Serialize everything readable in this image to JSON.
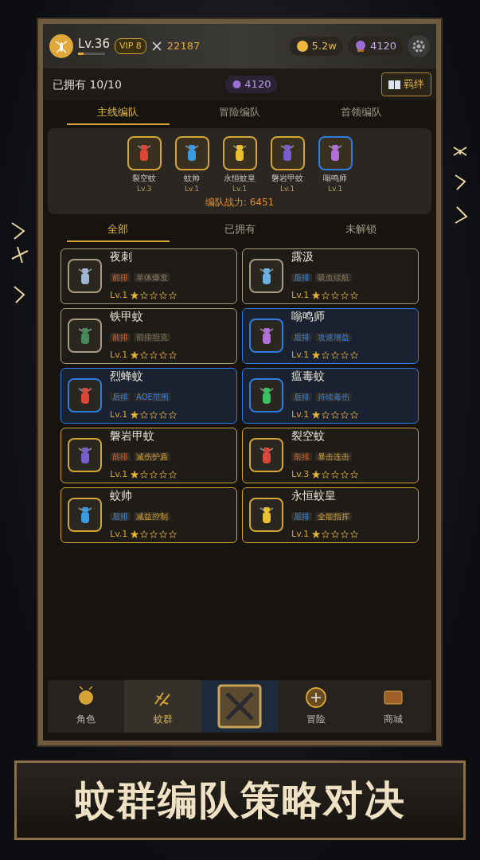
{
  "player": {
    "level_label": "Lv.36",
    "level": 0.2,
    "vip": "VIP 8",
    "power": "22187",
    "coins": "5.2w",
    "gems": "4120"
  },
  "owned": {
    "label": "已拥有 10/10",
    "gems": "4120",
    "bond_button": "羁绊"
  },
  "team_tabs": [
    {
      "label": "主线编队",
      "selected": true
    },
    {
      "label": "冒险编队",
      "selected": false
    },
    {
      "label": "首领编队",
      "selected": false
    }
  ],
  "formation": {
    "members": [
      {
        "name": "裂空蚊",
        "level": "Lv.3",
        "kind": "epic",
        "icon": {
          "color": "#d9483a"
        }
      },
      {
        "name": "蚊帅",
        "level": "Lv.1",
        "kind": "epic",
        "icon": {
          "color": "#3a9be0"
        }
      },
      {
        "name": "永恒蚊皇",
        "level": "Lv.1",
        "kind": "epic",
        "icon": {
          "color": "#e8c230"
        }
      },
      {
        "name": "磐岩甲蚊",
        "level": "Lv.1",
        "kind": "epic",
        "icon": {
          "color": "#7a5ed0"
        }
      },
      {
        "name": "嗡鸣师",
        "level": "Lv.1",
        "kind": "rare",
        "icon": {
          "color": "#b070d8"
        }
      }
    ],
    "power": "编队战力: 6451"
  },
  "filter_tabs": [
    {
      "label": "全部",
      "selected": true
    },
    {
      "label": "已拥有",
      "selected": false
    },
    {
      "label": "未解锁",
      "selected": false
    }
  ],
  "units": [
    {
      "name": "夜刺",
      "kind": "common",
      "icon": {
        "color": "#9fb4d0"
      },
      "position": {
        "text": "前排",
        "kind": "front"
      },
      "trait": "单体爆发",
      "level": "Lv.1",
      "stars": 1
    },
    {
      "name": "露汲",
      "kind": "common",
      "icon": {
        "color": "#6ab0e0"
      },
      "position": {
        "text": "后排",
        "kind": "back"
      },
      "trait": "吸血续航",
      "level": "Lv.1",
      "stars": 1
    },
    {
      "name": "铁甲蚊",
      "kind": "common",
      "icon": {
        "color": "#4a8a5a"
      },
      "position": {
        "text": "前排",
        "kind": "front"
      },
      "trait": "前排坦克",
      "level": "Lv.1",
      "stars": 1
    },
    {
      "name": "嗡鸣师",
      "kind": "rare",
      "icon": {
        "color": "#b070d8"
      },
      "position": {
        "text": "后排",
        "kind": "back"
      },
      "trait": "攻速增益",
      "level": "Lv.1",
      "stars": 1
    },
    {
      "name": "烈蜂蚊",
      "kind": "rare",
      "icon": {
        "color": "#d9483a"
      },
      "position": {
        "text": "后排",
        "kind": "back"
      },
      "trait": "AOE范围",
      "level": "Lv.1",
      "stars": 1
    },
    {
      "name": "瘟毒蚊",
      "kind": "rare",
      "icon": {
        "color": "#3ac060"
      },
      "position": {
        "text": "后排",
        "kind": "back"
      },
      "trait": "持续毒伤",
      "level": "Lv.1",
      "stars": 1
    },
    {
      "name": "磐岩甲蚊",
      "kind": "epic",
      "icon": {
        "color": "#7a5ed0"
      },
      "position": {
        "text": "前排",
        "kind": "front"
      },
      "trait": "减伤护盾",
      "level": "Lv.1",
      "stars": 1
    },
    {
      "name": "裂空蚊",
      "kind": "epic",
      "icon": {
        "color": "#d9483a"
      },
      "position": {
        "text": "前排",
        "kind": "front"
      },
      "trait": "暴击连击",
      "level": "Lv.3",
      "stars": 1
    },
    {
      "name": "蚊帅",
      "kind": "epic",
      "icon": {
        "color": "#3a9be0"
      },
      "position": {
        "text": "后排",
        "kind": "back"
      },
      "trait": "减益控制",
      "level": "Lv.1",
      "stars": 1
    },
    {
      "name": "永恒蚊皇",
      "kind": "epic",
      "icon": {
        "color": "#e8c230"
      },
      "position": {
        "text": "后排",
        "kind": "back"
      },
      "trait": "全能指挥",
      "level": "Lv.1",
      "stars": 1
    }
  ],
  "nav": [
    {
      "kind": "role",
      "label": "角色",
      "selected": false
    },
    {
      "kind": "swarm",
      "label": "蚊群",
      "selected": true
    },
    {
      "kind": "battle",
      "selected": false
    },
    {
      "kind": "adventure",
      "label": "冒险",
      "selected": false
    },
    {
      "kind": "shop",
      "label": "商城",
      "selected": false
    }
  ],
  "banner": "蚊群编队策略对决"
}
